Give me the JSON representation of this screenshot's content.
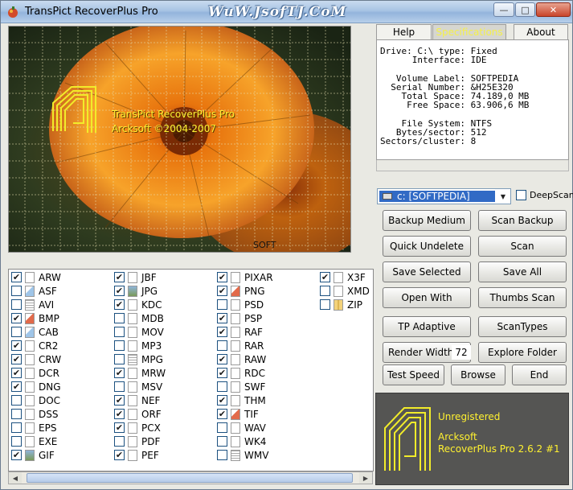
{
  "window": {
    "title": "TransPict RecoverPlus Pro",
    "watermark": "WuW.JsofTJ.CoM",
    "controls": [
      "minimize",
      "maximize",
      "close"
    ]
  },
  "preview": {
    "splash_title": "TransPict RecoverPlus Pro",
    "splash_copyright": "Arcksoft ©2004-2007",
    "overlay_mark": "SOFT"
  },
  "tabs": [
    {
      "label": "Help",
      "active": false
    },
    {
      "label": "Specifications",
      "active": true
    },
    {
      "label": "About",
      "active": false
    }
  ],
  "specs": {
    "drive": "Drive: C:\\ type: Fixed",
    "interface": "      Interface: IDE",
    "volume_label": "   Volume Label: SOFTPEDIA",
    "serial_number": "  Serial Number: &H25E320",
    "total_space": "    Total Space: 74.189,0 MB",
    "free_space": "     Free Space: 63.906,6 MB",
    "file_system": "    File System: NTFS",
    "bytes_sector": "   Bytes/sector: 512",
    "sectors_cluster": "Sectors/cluster: 8"
  },
  "drive": {
    "selected": "c: [SOFTPEDIA]",
    "deep_scan_label": "DeepScan",
    "deep_scan_checked": false
  },
  "buttons": {
    "backup_medium": "Backup Medium",
    "scan_backup": "Scan Backup",
    "quick_undelete": "Quick Undelete",
    "scan": "Scan",
    "save_selected": "Save Selected",
    "save_all": "Save All",
    "open_with": "Open With",
    "thumbs_scan": "Thumbs Scan",
    "tp_adaptive": "TP Adaptive",
    "scan_types": "ScanTypes",
    "render_width": "Render Width",
    "render_width_value": "72",
    "explore_folder": "Explore Folder",
    "test_speed": "Test Speed",
    "browse": "Browse",
    "end": "End"
  },
  "about": {
    "status": "Unregistered",
    "company": "Arcksoft",
    "version": "RecoverPlus Pro 2.6.2 #1"
  },
  "file_types": {
    "col1": [
      {
        "ext": "ARW",
        "checked": true,
        "icon": "doc"
      },
      {
        "ext": "ASF",
        "checked": false,
        "icon": "col"
      },
      {
        "ext": "AVI",
        "checked": false,
        "icon": "grid"
      },
      {
        "ext": "BMP",
        "checked": true,
        "icon": "red"
      },
      {
        "ext": "CAB",
        "checked": false,
        "icon": "col"
      },
      {
        "ext": "CR2",
        "checked": true,
        "icon": "doc"
      },
      {
        "ext": "CRW",
        "checked": true,
        "icon": "doc"
      },
      {
        "ext": "DCR",
        "checked": true,
        "icon": "doc"
      },
      {
        "ext": "DNG",
        "checked": true,
        "icon": "doc"
      },
      {
        "ext": "DOC",
        "checked": false,
        "icon": "doc"
      },
      {
        "ext": "DSS",
        "checked": false,
        "icon": "doc"
      },
      {
        "ext": "EPS",
        "checked": false,
        "icon": "doc"
      },
      {
        "ext": "EXE",
        "checked": false,
        "icon": "doc"
      },
      {
        "ext": "GIF",
        "checked": true,
        "icon": "img"
      }
    ],
    "col2": [
      {
        "ext": "JBF",
        "checked": true,
        "icon": "doc"
      },
      {
        "ext": "JPG",
        "checked": true,
        "icon": "img"
      },
      {
        "ext": "KDC",
        "checked": true,
        "icon": "doc"
      },
      {
        "ext": "MDB",
        "checked": false,
        "icon": "doc"
      },
      {
        "ext": "MOV",
        "checked": false,
        "icon": "doc"
      },
      {
        "ext": "MP3",
        "checked": false,
        "icon": "note"
      },
      {
        "ext": "MPG",
        "checked": false,
        "icon": "grid"
      },
      {
        "ext": "MRW",
        "checked": true,
        "icon": "doc"
      },
      {
        "ext": "MSV",
        "checked": false,
        "icon": "doc"
      },
      {
        "ext": "NEF",
        "checked": true,
        "icon": "doc"
      },
      {
        "ext": "ORF",
        "checked": true,
        "icon": "doc"
      },
      {
        "ext": "PCX",
        "checked": true,
        "icon": "doc"
      },
      {
        "ext": "PDF",
        "checked": false,
        "icon": "doc"
      },
      {
        "ext": "PEF",
        "checked": true,
        "icon": "doc"
      }
    ],
    "col3": [
      {
        "ext": "PIXAR",
        "checked": true,
        "icon": "doc"
      },
      {
        "ext": "PNG",
        "checked": true,
        "icon": "red"
      },
      {
        "ext": "PSD",
        "checked": false,
        "icon": "doc"
      },
      {
        "ext": "PSP",
        "checked": true,
        "icon": "doc"
      },
      {
        "ext": "RAF",
        "checked": true,
        "icon": "doc"
      },
      {
        "ext": "RAR",
        "checked": false,
        "icon": "doc"
      },
      {
        "ext": "RAW",
        "checked": true,
        "icon": "doc"
      },
      {
        "ext": "RDC",
        "checked": true,
        "icon": "doc"
      },
      {
        "ext": "SWF",
        "checked": false,
        "icon": "doc"
      },
      {
        "ext": "THM",
        "checked": true,
        "icon": "doc"
      },
      {
        "ext": "TIF",
        "checked": true,
        "icon": "red"
      },
      {
        "ext": "WAV",
        "checked": false,
        "icon": "note"
      },
      {
        "ext": "WK4",
        "checked": false,
        "icon": "doc"
      },
      {
        "ext": "WMV",
        "checked": false,
        "icon": "grid"
      }
    ],
    "col4": [
      {
        "ext": "X3F",
        "checked": true,
        "icon": "doc"
      },
      {
        "ext": "XMD",
        "checked": false,
        "icon": "doc"
      },
      {
        "ext": "ZIP",
        "checked": false,
        "icon": "zip"
      }
    ]
  }
}
